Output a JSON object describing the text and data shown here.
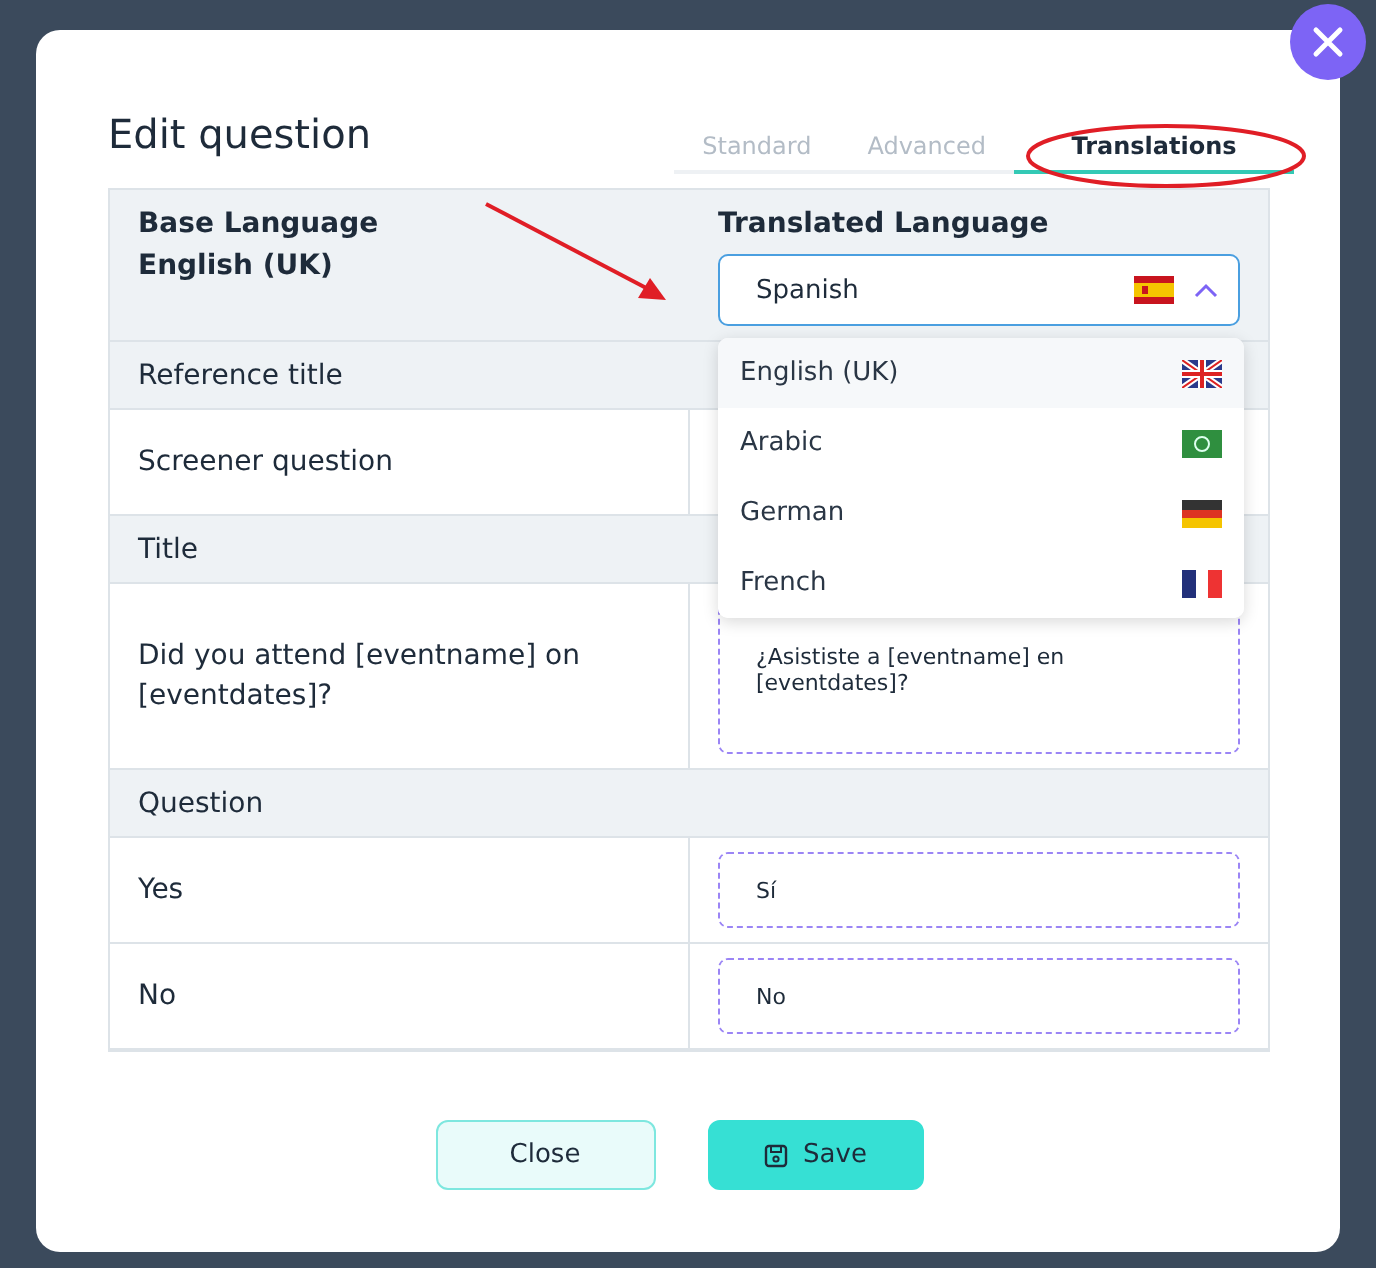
{
  "dialog": {
    "title": "Edit question"
  },
  "tabs": [
    {
      "label": "Standard",
      "selected": false
    },
    {
      "label": "Advanced",
      "selected": false
    },
    {
      "label": "Translations",
      "selected": true
    }
  ],
  "header": {
    "base_label": "Base Language",
    "base_value": "English (UK)",
    "translated_label": "Translated Language",
    "language_select": {
      "value": "Spanish",
      "expanded": true
    }
  },
  "language_options": [
    {
      "label": "English (UK)",
      "selected": true
    },
    {
      "label": "Arabic",
      "selected": false
    },
    {
      "label": "German",
      "selected": false
    },
    {
      "label": "French",
      "selected": false
    }
  ],
  "rows": [
    {
      "kind": "section",
      "label": "Reference title"
    },
    {
      "kind": "pair",
      "label": "Screener question"
    },
    {
      "kind": "section",
      "label": "Title"
    },
    {
      "kind": "pair",
      "label": "Did you attend [eventname] on [eventdates]?",
      "translation": "¿Asististe a [eventname] en [eventdates]?",
      "tall": true
    },
    {
      "kind": "section",
      "label": "Question"
    },
    {
      "kind": "pair",
      "label": "Yes",
      "translation": "Sí"
    },
    {
      "kind": "pair",
      "label": "No",
      "translation": "No"
    }
  ],
  "buttons": [
    {
      "label": "Close",
      "kind": "secondary"
    },
    {
      "label": "Save",
      "kind": "primary"
    }
  ]
}
